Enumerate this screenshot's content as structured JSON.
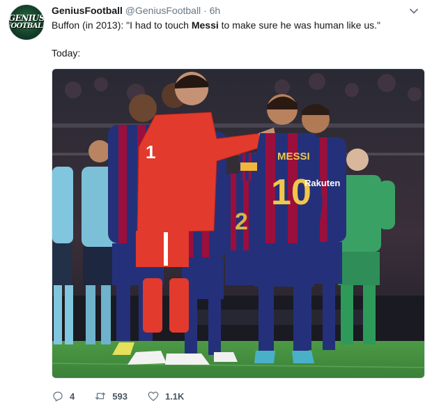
{
  "tweet": {
    "avatar": {
      "text_line1": "GENIUS",
      "text_line2": "FOOTBALL"
    },
    "display_name": "GeniusFootball",
    "handle": "@GeniusFootball",
    "separator": "·",
    "time": "6h",
    "text_before": "Buffon (in 2013): \"I had to touch ",
    "text_bold": "Messi",
    "text_after": " to make sure he was human like us.\"",
    "text_line2": "Today:",
    "media": {
      "description": "photo",
      "jersey_name": "MESSI",
      "jersey_number": "10",
      "sponsor": "Rakuten",
      "gk_number": "1",
      "player2_number": "2"
    },
    "actions": {
      "replies": "4",
      "retweets": "593",
      "likes": "1.1K"
    }
  },
  "colors": {
    "text": "#14171a",
    "muted": "#657786",
    "barca_blue": "#1e2b6e",
    "barca_red": "#a50034",
    "juve_red": "#e23a2c",
    "keeper_green": "#3aa165",
    "pitch": "#3f8a3e"
  },
  "icons": [
    "chevron-down-icon",
    "reply-icon",
    "retweet-icon",
    "like-icon"
  ]
}
